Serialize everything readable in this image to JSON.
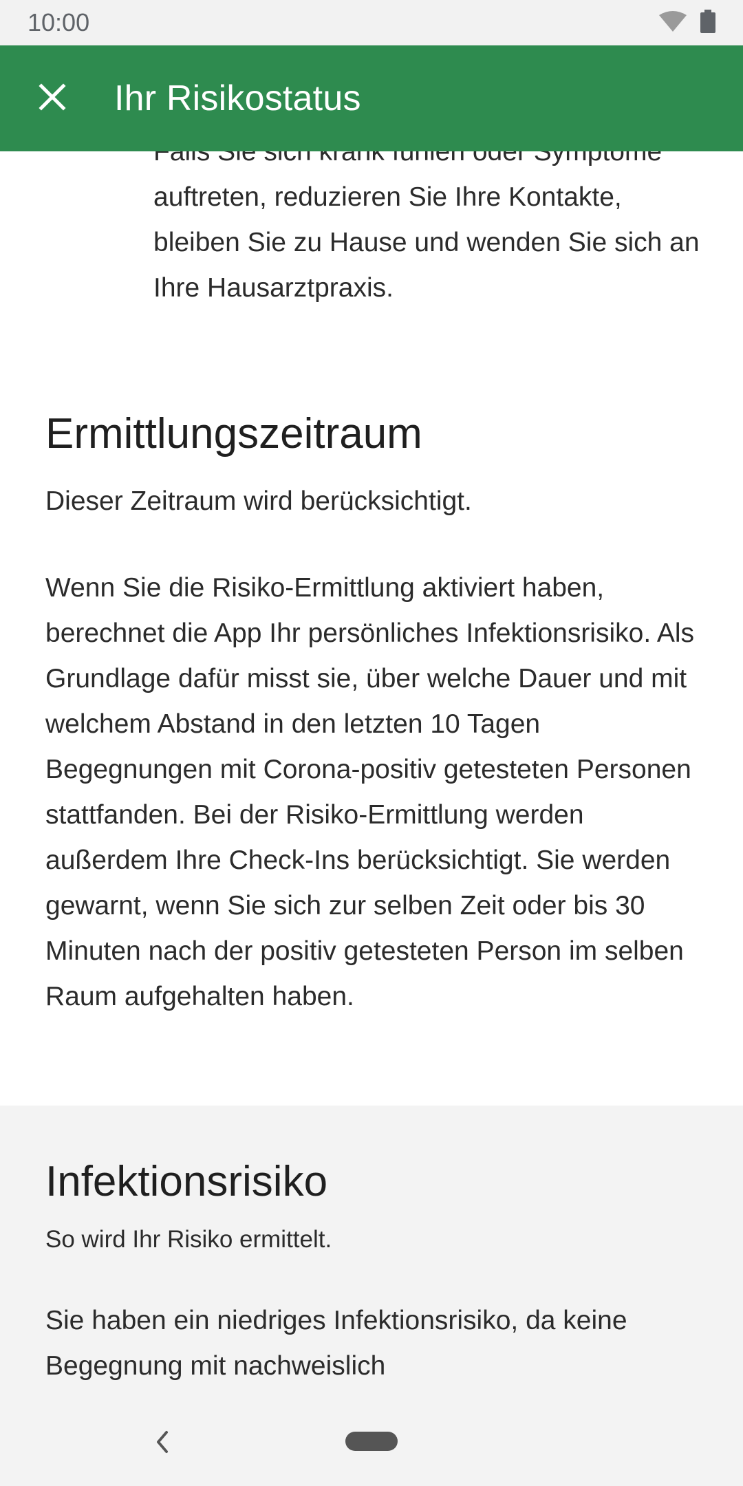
{
  "status_bar": {
    "time": "10:00"
  },
  "app_bar": {
    "title": "Ihr Risikostatus",
    "close_icon": "close-icon"
  },
  "intro": {
    "paragraph": "Falls Sie sich krank fühlen oder Symptome auftreten, reduzieren Sie Ihre Kontakte, bleiben Sie zu Hause und wenden Sie sich an Ihre Hausarztpraxis."
  },
  "ermittlungszeitraum": {
    "title": "Ermittlungszeitraum",
    "subtitle": "Dieser Zeitraum wird berücksichtigt.",
    "body": "Wenn Sie die Risiko-Ermittlung aktiviert haben, berechnet die App Ihr persönliches Infektionsrisiko. Als Grundlage dafür misst sie, über welche Dauer und mit welchem Abstand in den letzten 10 Tagen Begegnungen mit Corona-positiv getesteten Personen stattfanden. Bei der Risiko-Ermittlung werden außerdem Ihre Check-Ins berücksichtigt. Sie werden gewarnt, wenn Sie sich zur selben Zeit oder bis 30 Minuten nach der positiv getesteten Person im selben Raum aufgehalten haben."
  },
  "infektionsrisiko": {
    "title": "Infektionsrisiko",
    "subtitle": "So wird Ihr Risiko ermittelt.",
    "body": "Sie haben ein niedriges Infektionsrisiko, da keine Begegnung mit nachweislich"
  },
  "colors": {
    "app_bar": "#2e8b4f",
    "status_bar": "#f2f2f2",
    "gray_section": "#f3f3f3"
  }
}
